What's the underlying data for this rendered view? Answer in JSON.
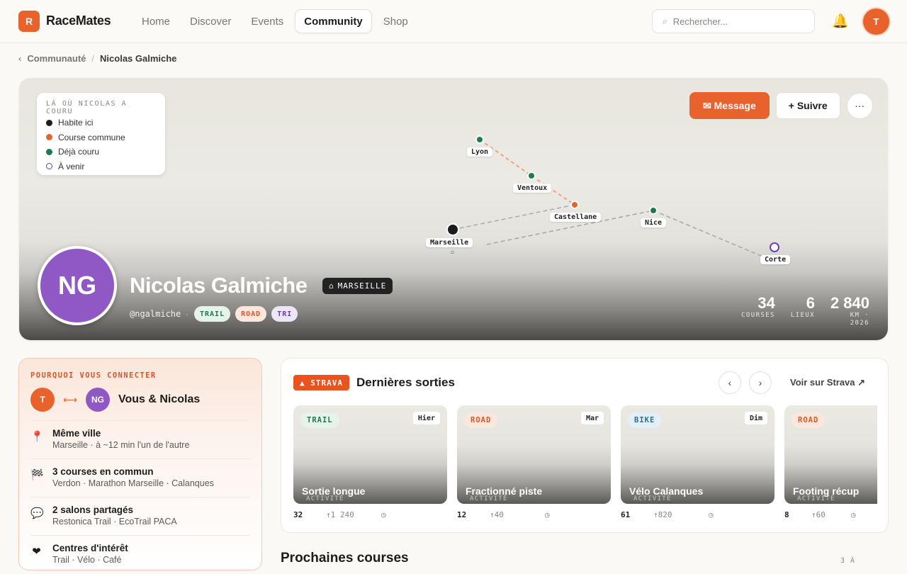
{
  "app": {
    "logo_letter": "R",
    "name": "RaceMates"
  },
  "nav": {
    "items": [
      "Home",
      "Discover",
      "Events",
      "Community",
      "Shop"
    ],
    "active": "Community"
  },
  "search": {
    "placeholder": "Rechercher..."
  },
  "user": {
    "initial": "T"
  },
  "breadcrumb": {
    "parent": "Communauté",
    "separator": "/",
    "current": "Nicolas Galmiche"
  },
  "map": {
    "legend_title": "LÀ OÙ NICOLAS A COURU",
    "legend": [
      {
        "label": "Habite ici",
        "color": "#1c1c1c"
      },
      {
        "label": "Course commune",
        "color": "#e8622c"
      },
      {
        "label": "Déjà couru",
        "color": "#1f7a4f"
      },
      {
        "label": "À venir",
        "color": "#6b3fb8"
      }
    ],
    "places": [
      "Lyon",
      "Ventoux",
      "Castellane",
      "Nice",
      "Marseille",
      "Corte"
    ],
    "home_icon": "⌂"
  },
  "actions": {
    "message": "✉ Message",
    "follow": "+ Suivre",
    "more": "···"
  },
  "profile": {
    "initials": "NG",
    "name": "Nicolas Galmiche",
    "city": "MARSEILLE",
    "handle": "@ngalmiche",
    "tags": [
      "TRAIL",
      "ROAD",
      "TRI"
    ],
    "stats": [
      {
        "value": "34",
        "label": "COURSES"
      },
      {
        "value": "6",
        "label": "LIEUX"
      },
      {
        "value": "2 840",
        "label": "KM · 2026"
      }
    ]
  },
  "why": {
    "heading": "POURQUOI VOUS CONNECTER",
    "me_initial": "T",
    "them_initials": "NG",
    "title": "Vous & Nicolas",
    "reasons": [
      {
        "icon": "📍",
        "title": "Même ville",
        "sub": "Marseille · à ~12 min l'un de l'autre"
      },
      {
        "icon": "🏁",
        "title": "3 courses en commun",
        "sub": "Verdon · Marathon Marseille · Calanques"
      },
      {
        "icon": "💬",
        "title": "2 salons partagés",
        "sub": "Restonica Trail · EcoTrail PACA"
      },
      {
        "icon": "❤",
        "title": "Centres d'intérêt",
        "sub": "Trail · Vélo · Café"
      }
    ]
  },
  "strava": {
    "badge": "▲ STRAVA",
    "title": "Dernières sorties",
    "link": "Voir sur Strava ↗",
    "activities": [
      {
        "tag": "TRAIL",
        "when": "Hier",
        "title": "Sortie longue",
        "caption": "ACTIVITÉ",
        "km": "32",
        "elev": "↑1 240",
        "time": "◷"
      },
      {
        "tag": "ROAD",
        "when": "Mar",
        "title": "Fractionné piste",
        "caption": "ACTIVITÉ",
        "km": "12",
        "elev": "↑40",
        "time": "◷"
      },
      {
        "tag": "BIKE",
        "when": "Dim",
        "title": "Vélo Calanques",
        "caption": "ACTIVITÉ",
        "km": "61",
        "elev": "↑820",
        "time": "◷"
      },
      {
        "tag": "ROAD",
        "when": "",
        "title": "Footing récup",
        "caption": "ACTIVITÉ",
        "km": "8",
        "elev": "↑60",
        "time": "◷"
      }
    ]
  },
  "upcoming": {
    "title": "Prochaines courses",
    "count": "3 À"
  }
}
